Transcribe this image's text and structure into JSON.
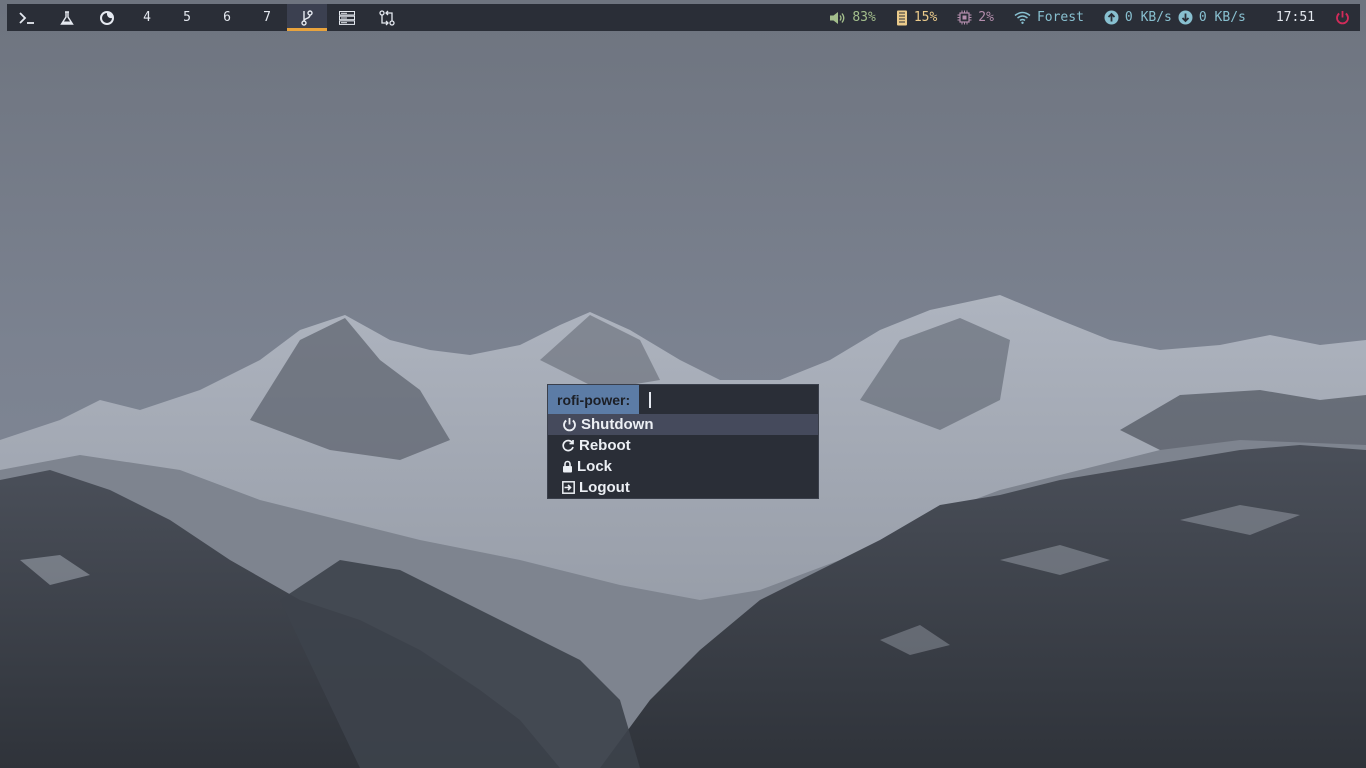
{
  "wallpaper": {
    "description_icon": "mountains-wallpaper"
  },
  "topbar": {
    "workspaces": [
      {
        "type": "icon",
        "icon": "terminal-icon"
      },
      {
        "type": "icon",
        "icon": "flask-icon"
      },
      {
        "type": "icon",
        "icon": "firefox-icon"
      },
      {
        "type": "text",
        "label": "4"
      },
      {
        "type": "text",
        "label": "5"
      },
      {
        "type": "text",
        "label": "6"
      },
      {
        "type": "text",
        "label": "7"
      },
      {
        "type": "icon",
        "icon": "git-branch-icon",
        "active": true
      },
      {
        "type": "icon",
        "icon": "server-icon"
      },
      {
        "type": "icon",
        "icon": "git-compare-icon"
      }
    ],
    "volume": {
      "icon": "volume-icon",
      "value": "83%",
      "color": "#a3be8c"
    },
    "memory": {
      "icon": "memory-icon",
      "value": "15%",
      "color": "#ebcb8b"
    },
    "cpu": {
      "icon": "cpu-icon",
      "value": "2%",
      "color": "#b48ead"
    },
    "wifi": {
      "icon": "wifi-icon",
      "ssid": "Forest",
      "color": "#88c0d0"
    },
    "upload": {
      "icon": "upload-arrow-icon",
      "value": "0 KB/s"
    },
    "download": {
      "icon": "download-arrow-icon",
      "value": "0 KB/s"
    },
    "clock": "17:51",
    "power": {
      "icon": "power-icon",
      "color": "#d22b5a"
    },
    "accent_color": "#e8a33d"
  },
  "rofi": {
    "prompt": "rofi-power:",
    "input_value": "",
    "items": [
      {
        "icon": "power-icon",
        "label": "Shutdown",
        "selected": true
      },
      {
        "icon": "reboot-icon",
        "label": "Reboot",
        "selected": false
      },
      {
        "icon": "lock-icon",
        "label": "Lock",
        "selected": false
      },
      {
        "icon": "logout-icon",
        "label": "Logout",
        "selected": false
      }
    ]
  }
}
